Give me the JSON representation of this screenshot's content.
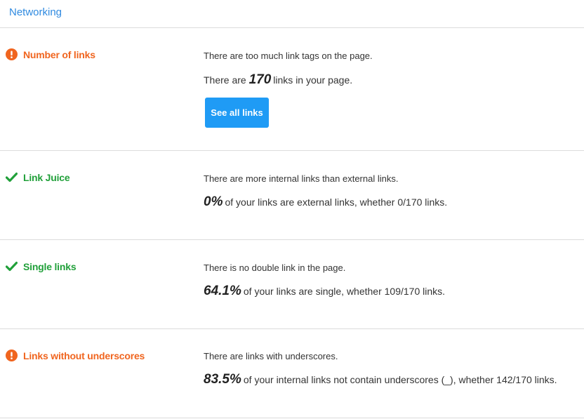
{
  "header": {
    "title": "Networking"
  },
  "checks": [
    {
      "label": "Number of links",
      "status": "warning",
      "description": "There are too much link tags on the page.",
      "stat_prefix": "There are",
      "stat_value": "170",
      "stat_suffix": "links in your page.",
      "button_label": "See all links"
    },
    {
      "label": "Link Juice",
      "status": "ok",
      "description": "There are more internal links than external links.",
      "stat_value": "0%",
      "stat_suffix": "of your links are external links, whether 0/170 links."
    },
    {
      "label": "Single links",
      "status": "ok",
      "description": "There is no double link in the page.",
      "stat_value": "64.1%",
      "stat_suffix": "of your links are single, whether 109/170 links."
    },
    {
      "label": "Links without underscores",
      "status": "warning",
      "description": "There are links with underscores.",
      "stat_value": "83.5%",
      "stat_suffix": "of your internal links not contain underscores (_), whether 142/170 links."
    }
  ],
  "colors": {
    "warning": "#f0651f",
    "ok": "#21a03a",
    "link": "#2f8ae0",
    "button": "#1f9bf5"
  }
}
